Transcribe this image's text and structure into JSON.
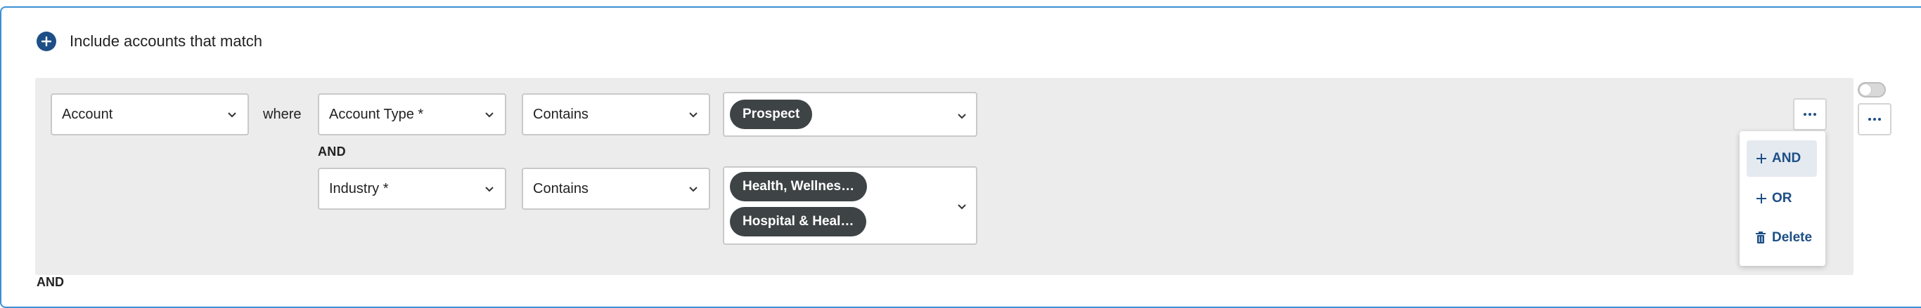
{
  "header": {
    "title": "Include accounts that match"
  },
  "rule": {
    "entity_select": "Account",
    "where_label": "where",
    "conditions": [
      {
        "field": "Account Type *",
        "operator": "Contains",
        "values": [
          "Prospect"
        ]
      },
      {
        "field": "Industry *",
        "operator": "Contains",
        "values": [
          "Health, Wellnes…",
          "Hospital & Heal…"
        ]
      }
    ],
    "joiner_label": "AND"
  },
  "menu": {
    "items": [
      "AND",
      "OR",
      "Delete"
    ]
  },
  "footer": {
    "joiner_label": "AND"
  },
  "colors": {
    "accent": "#1d4f86",
    "chip": "#3e4346",
    "panel": "#ececec",
    "focus_border": "#3b8fd4"
  },
  "icons": [
    "add-circle-icon",
    "chevron-down-icon",
    "more-horizontal-icon",
    "plus-icon",
    "trash-icon",
    "toggle-switch"
  ]
}
